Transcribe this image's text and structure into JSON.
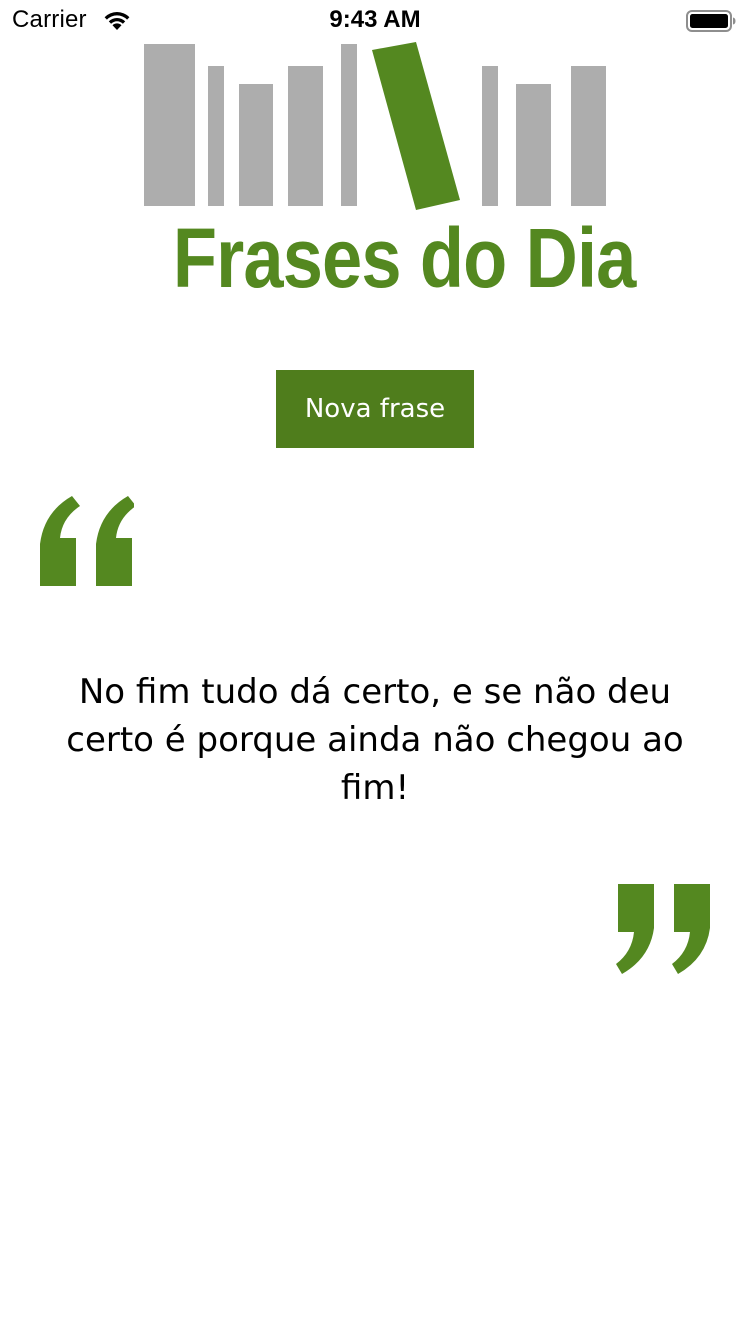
{
  "status_bar": {
    "carrier": "Carrier",
    "time": "9:43 AM",
    "wifi_icon": "wifi-icon",
    "battery_icon": "battery-icon"
  },
  "logo": {
    "text": "Frases do Dia",
    "icon": "books-logo"
  },
  "button": {
    "label": "Nova frase"
  },
  "quote": {
    "text": "No fim tudo dá certo, e se não deu certo é porque ainda não chegou ao fim!",
    "open_icon": "open-quote-icon",
    "close_icon": "close-quote-icon"
  },
  "colors": {
    "brand_green": "#548820",
    "button_green": "#4f7d1c",
    "book_gray": "#adadad"
  }
}
